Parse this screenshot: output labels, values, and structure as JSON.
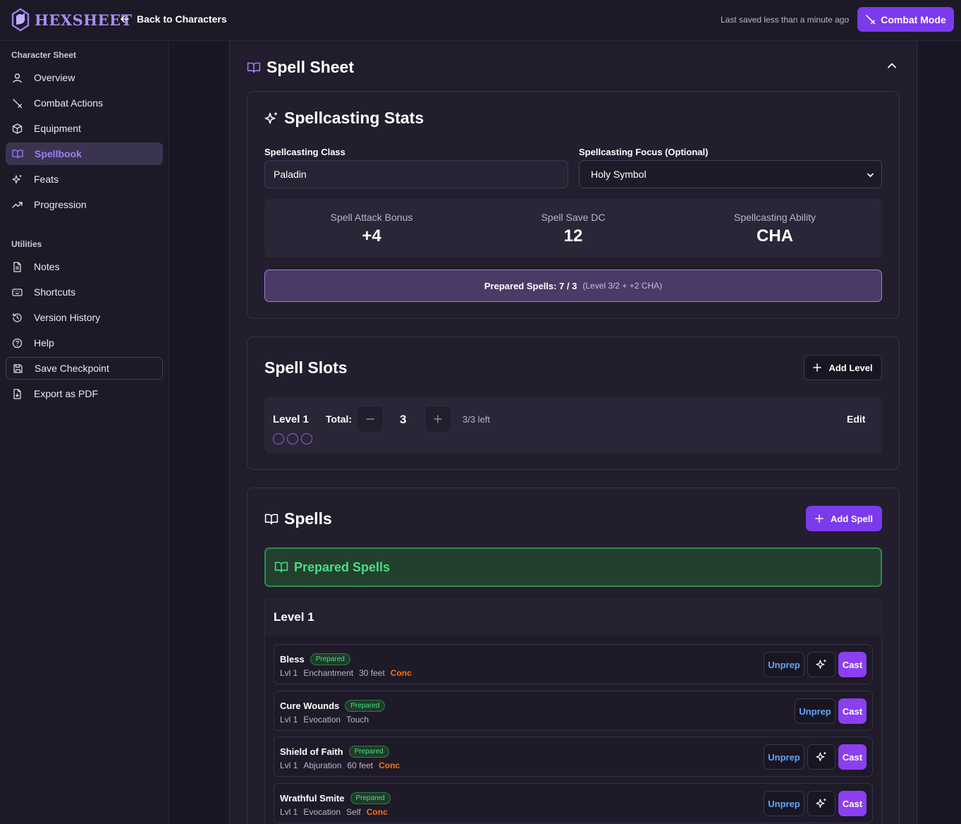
{
  "header": {
    "app_name": "HEXSHEET",
    "back_label": "Back to Characters",
    "saved_status": "Last saved less than a minute ago",
    "combat_mode_label": "Combat Mode"
  },
  "sidebar": {
    "section_character": "Character Sheet",
    "items": [
      {
        "label": "Overview"
      },
      {
        "label": "Combat Actions"
      },
      {
        "label": "Equipment"
      },
      {
        "label": "Spellbook"
      },
      {
        "label": "Feats"
      },
      {
        "label": "Progression"
      }
    ],
    "section_utilities": "Utilities",
    "utilities": [
      {
        "label": "Notes"
      },
      {
        "label": "Shortcuts"
      },
      {
        "label": "Version History"
      },
      {
        "label": "Help"
      },
      {
        "label": "Save Checkpoint"
      },
      {
        "label": "Export as PDF"
      }
    ]
  },
  "spell_sheet": {
    "title": "Spell Sheet",
    "stats_card": {
      "title": "Spellcasting Stats",
      "class_label": "Spellcasting Class",
      "class_value": "Paladin",
      "focus_label": "Spellcasting Focus (Optional)",
      "focus_value": "Holy Symbol",
      "attack_label": "Spell Attack Bonus",
      "attack_value": "+4",
      "dc_label": "Spell Save DC",
      "dc_value": "12",
      "ability_label": "Spellcasting Ability",
      "ability_value": "CHA",
      "prepared_main": "Prepared Spells: 7 / 3",
      "prepared_sub": "(Level 3/2 + +2 CHA)"
    },
    "slots_card": {
      "title": "Spell Slots",
      "add_level_label": "Add Level",
      "level_label": "Level 1",
      "total_label": "Total:",
      "total_value": "3",
      "left_label": "3/3 left",
      "edit_label": "Edit"
    },
    "spells_card": {
      "title": "Spells",
      "add_spell_label": "Add Spell",
      "prepared_header": "Prepared Spells",
      "level_group_label": "Level 1",
      "spells": [
        {
          "name": "Bless",
          "badge": "Prepared",
          "level": "Lvl 1",
          "school": "Enchantment",
          "range": "30 feet",
          "conc": "Conc",
          "unprep": "Unprep",
          "cast": "Cast"
        },
        {
          "name": "Cure Wounds",
          "badge": "Prepared",
          "level": "Lvl 1",
          "school": "Evocation",
          "range": "Touch",
          "conc": "",
          "unprep": "Unprep",
          "cast": "Cast"
        },
        {
          "name": "Shield of Faith",
          "badge": "Prepared",
          "level": "Lvl 1",
          "school": "Abjuration",
          "range": "60 feet",
          "conc": "Conc",
          "unprep": "Unprep",
          "cast": "Cast"
        },
        {
          "name": "Wrathful Smite",
          "badge": "Prepared",
          "level": "Lvl 1",
          "school": "Evocation",
          "range": "Self",
          "conc": "Conc",
          "unprep": "Unprep",
          "cast": "Cast"
        }
      ]
    }
  },
  "colors": {
    "accent": "#7c3aed",
    "prepared_green": "#4ade80",
    "conc_orange": "#f97316",
    "unprep_blue": "#60a5fa"
  }
}
